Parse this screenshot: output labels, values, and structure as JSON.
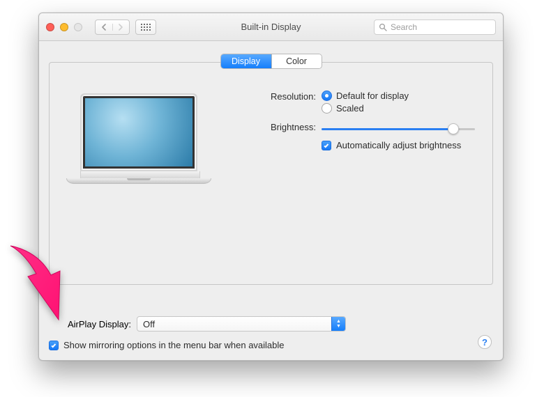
{
  "window": {
    "title": "Built-in Display"
  },
  "toolbar": {
    "search_placeholder": "Search"
  },
  "tabs": {
    "display": "Display",
    "color": "Color",
    "active": "display"
  },
  "settings": {
    "resolution_label": "Resolution:",
    "resolution_options": {
      "default": "Default for display",
      "scaled": "Scaled"
    },
    "resolution_selected": "default",
    "brightness_label": "Brightness:",
    "brightness_value_pct": 86,
    "auto_brightness_label": "Automatically adjust brightness",
    "auto_brightness_checked": true
  },
  "airplay": {
    "label": "AirPlay Display:",
    "value": "Off"
  },
  "mirroring": {
    "label": "Show mirroring options in the menu bar when available",
    "checked": true
  },
  "help_symbol": "?",
  "colors": {
    "accent": "#157efb"
  }
}
